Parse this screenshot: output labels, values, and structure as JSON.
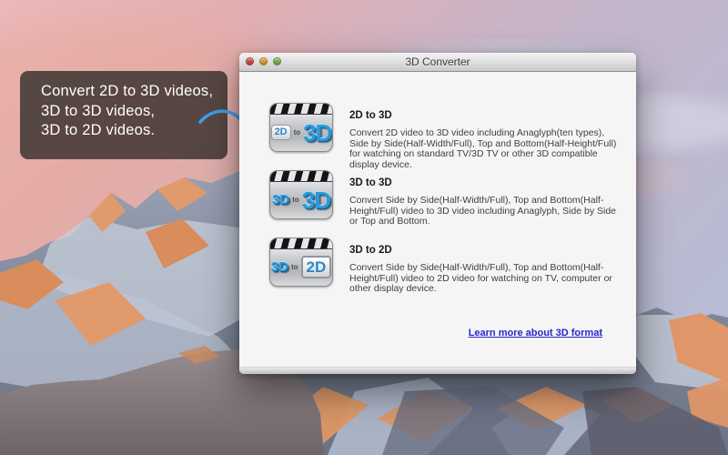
{
  "theme": {
    "link_blue": "#2626cf",
    "arrow_blue": "#3aa0ea",
    "icon_text_blue": "#2a9ad8",
    "callout_bg": "rgba(66,55,52,0.87)"
  },
  "callout": {
    "lines": [
      "Convert 2D to 3D videos,",
      "3D to 3D videos,",
      "3D to 2D videos."
    ]
  },
  "window": {
    "title": "3D Converter",
    "link_label": "Learn more about 3D format",
    "modes": [
      {
        "title": "2D to 3D",
        "description": "Convert 2D video to 3D video including Anaglyph(ten types), Side by Side(Half-Width/Full), Top and Bottom(Half-Height/Full) for watching on standard TV/3D TV or other 3D compatible display device.",
        "icon": {
          "from": "2D",
          "to_word": "to",
          "to": "3D"
        }
      },
      {
        "title": "3D to 3D",
        "description": "Convert Side by Side(Half-Width/Full), Top and Bottom(Half-Height/Full) video to 3D video including Anaglyph, Side by Side or Top and Bottom.",
        "icon": {
          "from": "3D",
          "to_word": "to",
          "to": "3D"
        }
      },
      {
        "title": "3D to 2D",
        "description": "Convert Side by Side(Half-Width/Full), Top and Bottom(Half-Height/Full) video to 2D video for watching on TV, computer or other display device.",
        "icon": {
          "from": "3D",
          "to_word": "to",
          "to": "2D"
        }
      }
    ]
  }
}
